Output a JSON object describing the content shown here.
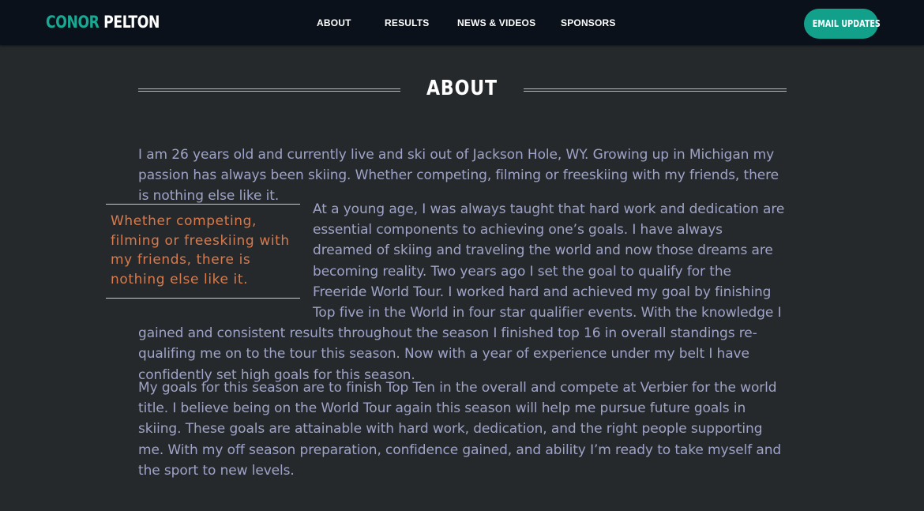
{
  "header": {
    "logo_first": "CONOR",
    "logo_last": "PELTON",
    "nav": [
      "ABOUT",
      "RESULTS",
      "NEWS & VIDEOS",
      "SPONSORS"
    ],
    "cta": "EMAIL UPDATES"
  },
  "section": {
    "title": "ABOUT"
  },
  "content": {
    "paragraph1": "I am 26 years old and currently live and ski out of Jackson Hole, WY. Growing up in Michigan my passion has always been skiing. Whether competing, filming or freeskiing with my friends, there is nothing else like it.",
    "pullquote": "Whether competing, filming or freeskiing with my friends, there is nothing else like it.",
    "paragraph2": "At a young age, I was always taught that hard work and dedication are essential components to achieving one’s goals. I have always dreamed of skiing and traveling the world and now those dreams are becoming reality. Two years ago I set the goal to qualify for the Freeride World Tour. I worked hard and achieved my goal by finishing Top five in the World in four star qualifier events. With the knowledge I gained and consistent results throughout the season I finished top 16 in overall standings re-qualifing me on to the tour this season. Now with a year of experience under my belt I have confidently set high goals for this season.",
    "paragraph3": "My goals for this season are to finish Top Ten in the overall and compete at Verbier for the world title. I believe being on the World Tour again this season will help me pursue future goals in skiing. These goals are attainable with hard work, dedication, and the right people supporting me. With my off season preparation, confidence gained, and ability I’m ready to take myself and the sport to new levels."
  },
  "colors": {
    "accent": "#13a08b",
    "pullquote": "#d87a4c",
    "body_text": "#9fa3c7",
    "background": "#25292b",
    "nav_bg": "#0b111a"
  }
}
